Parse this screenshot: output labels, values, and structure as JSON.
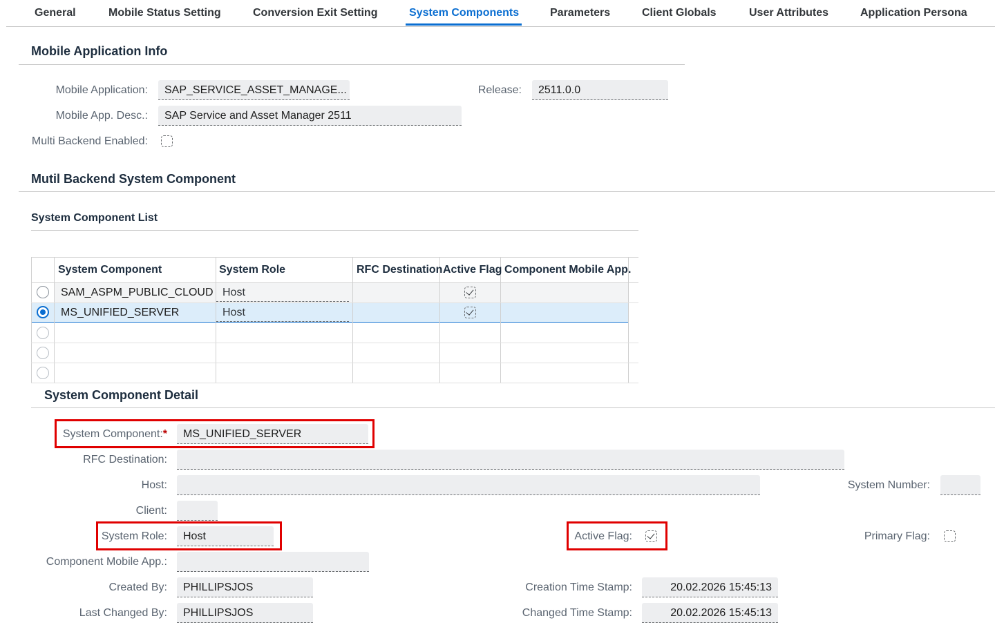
{
  "tabs": [
    {
      "label": "General"
    },
    {
      "label": "Mobile Status Setting"
    },
    {
      "label": "Conversion Exit Setting"
    },
    {
      "label": "System Components",
      "active": true
    },
    {
      "label": "Parameters"
    },
    {
      "label": "Client Globals"
    },
    {
      "label": "User Attributes"
    },
    {
      "label": "Application Persona"
    }
  ],
  "app_info": {
    "title": "Mobile Application Info",
    "mobile_application_label": "Mobile Application:",
    "mobile_application_value": "SAP_SERVICE_ASSET_MANAGE...",
    "release_label": "Release:",
    "release_value": "2511.0.0",
    "desc_label": "Mobile App. Desc.:",
    "desc_value": "SAP Service and Asset Manager 2511",
    "multi_backend_label": "Multi Backend Enabled:",
    "multi_backend_checked": false
  },
  "multi_backend": {
    "title": "Mutil Backend System Component",
    "list_title": "System Component List",
    "columns": [
      "System Component",
      "System Role",
      "RFC Destination",
      "Active Flag",
      "Component Mobile App."
    ],
    "rows": [
      {
        "component": "SAM_ASPM_PUBLIC_CLOUD",
        "role": "Host",
        "rfc": "",
        "active": true,
        "mobile_app": "",
        "selected": false
      },
      {
        "component": "MS_UNIFIED_SERVER",
        "role": "Host",
        "rfc": "",
        "active": true,
        "mobile_app": "",
        "selected": true
      }
    ]
  },
  "detail": {
    "title": "System Component Detail",
    "system_component_label": "System Component:",
    "required_mark": "*",
    "system_component_value": "MS_UNIFIED_SERVER",
    "rfc_label": "RFC Destination:",
    "rfc_value": "",
    "host_label": "Host:",
    "host_value": "",
    "system_number_label": "System Number:",
    "system_number_value": "",
    "client_label": "Client:",
    "client_value": "",
    "system_role_label": "System Role:",
    "system_role_value": "Host",
    "active_flag_label": "Active Flag:",
    "active_flag_checked": true,
    "primary_flag_label": "Primary Flag:",
    "primary_flag_checked": false,
    "component_mobile_app_label": "Component Mobile App.:",
    "component_mobile_app_value": "",
    "created_by_label": "Created By:",
    "created_by_value": "PHILLIPSJOS",
    "creation_ts_label": "Creation Time Stamp:",
    "creation_ts_value": "20.02.2026 15:45:13",
    "last_changed_label": "Last Changed By:",
    "last_changed_value": "PHILLIPSJOS",
    "changed_ts_label": "Changed Time Stamp:",
    "changed_ts_value": "20.02.2026 15:45:13"
  },
  "colors": {
    "accent": "#0a6ed1",
    "highlight": "#e00000",
    "selected_row": "#dcedfa"
  }
}
